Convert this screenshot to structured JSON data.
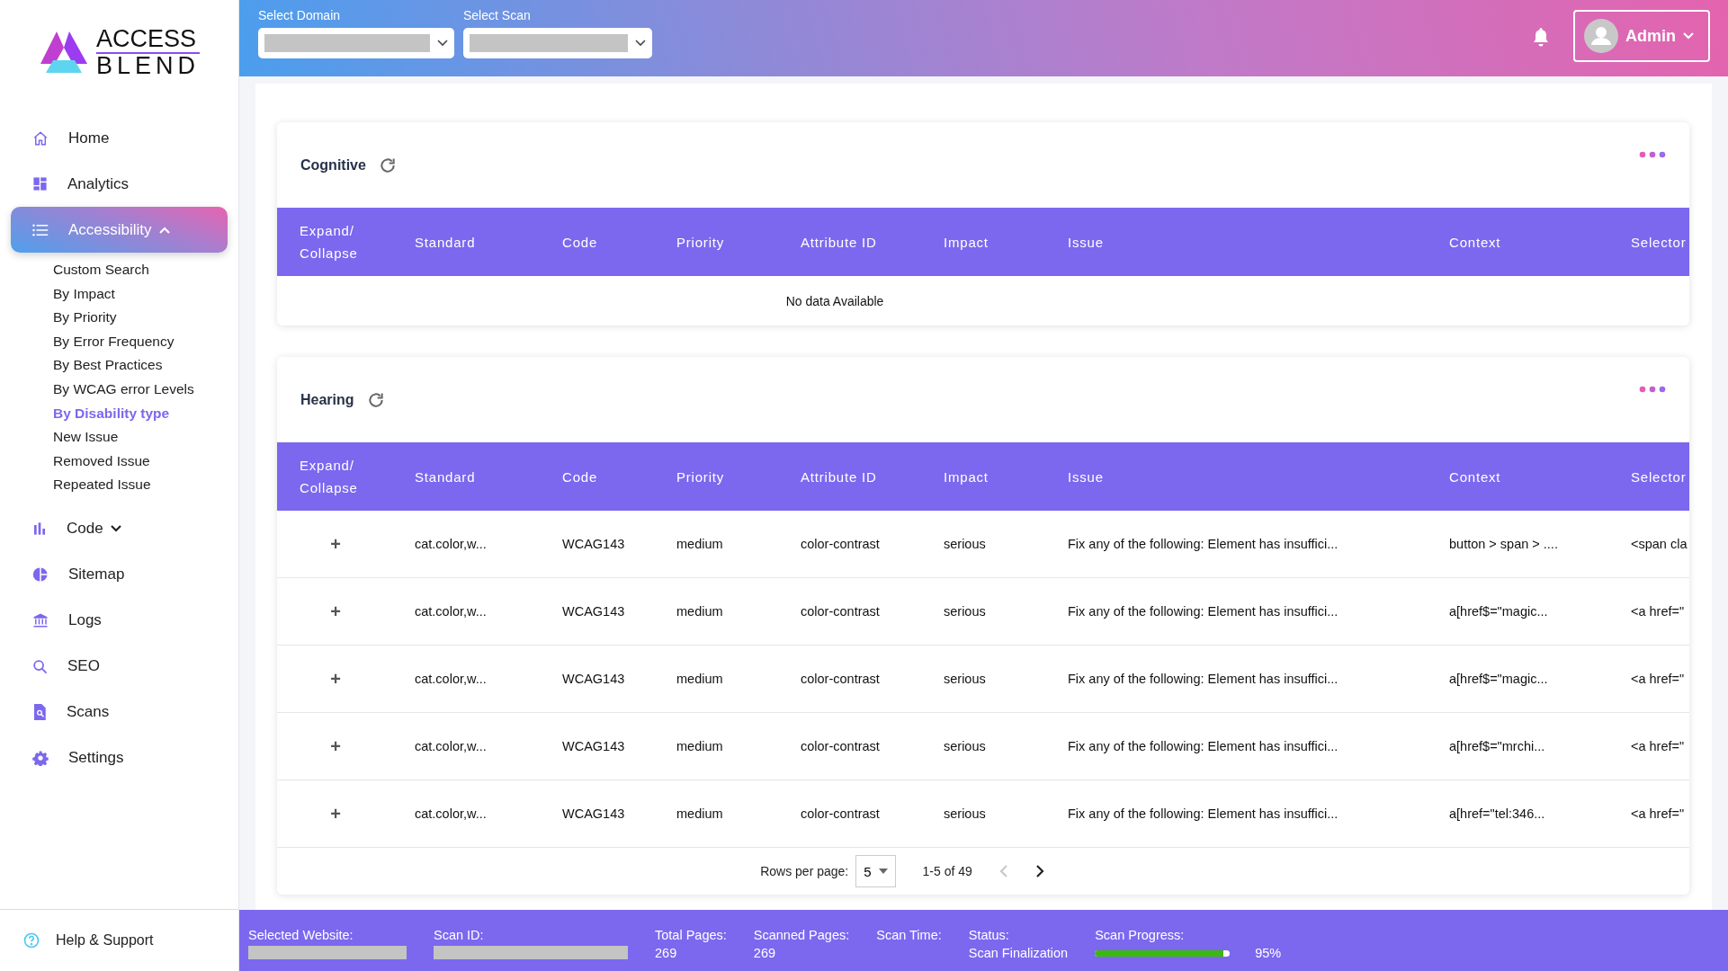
{
  "logo": {
    "line_1": "ACCESS",
    "line_2": "BLEND"
  },
  "sidebar": {
    "items": [
      {
        "label": "Home",
        "selected": false
      },
      {
        "label": "Analytics",
        "selected": false
      },
      {
        "label": "Accessibility",
        "selected": true,
        "expanded": true,
        "children": [
          {
            "label": "Custom Search",
            "selected": false
          },
          {
            "label": "By Impact",
            "selected": false
          },
          {
            "label": "By Priority",
            "selected": false
          },
          {
            "label": "By Error Frequency",
            "selected": false
          },
          {
            "label": "By Best Practices",
            "selected": false
          },
          {
            "label": "By WCAG error Levels",
            "selected": false
          },
          {
            "label": "By Disability type",
            "selected": true
          },
          {
            "label": "New Issue",
            "selected": false
          },
          {
            "label": "Removed Issue",
            "selected": false
          },
          {
            "label": "Repeated Issue",
            "selected": false
          }
        ]
      },
      {
        "label": "Code",
        "selected": false,
        "expanded": false
      },
      {
        "label": "Sitemap",
        "selected": false
      },
      {
        "label": "Logs",
        "selected": false
      },
      {
        "label": "SEO",
        "selected": false
      },
      {
        "label": "Scans",
        "selected": false
      },
      {
        "label": "Settings",
        "selected": false
      }
    ],
    "help": "Help & Support"
  },
  "header": {
    "selects": [
      {
        "label": "Select Domain"
      },
      {
        "label": "Select Scan"
      }
    ],
    "user": "Admin"
  },
  "sections": [
    {
      "title": "Cognitive",
      "columns": [
        "Expand/ Collapse",
        "Standard",
        "Code",
        "Priority",
        "Attribute ID",
        "Impact",
        "Issue",
        "Context",
        "Selector"
      ],
      "empty_message": "No data Available"
    },
    {
      "title": "Hearing",
      "columns": [
        "Expand/ Collapse",
        "Standard",
        "Code",
        "Priority",
        "Attribute ID",
        "Impact",
        "Issue",
        "Context",
        "Selector"
      ],
      "rows": [
        {
          "cells": [
            "+",
            "cat.color,w...",
            "WCAG143",
            "medium",
            "color-contrast",
            "serious",
            "Fix any of the following: Element has insuffici...",
            "button > span > ....",
            "<span cla"
          ]
        },
        {
          "cells": [
            "+",
            "cat.color,w...",
            "WCAG143",
            "medium",
            "color-contrast",
            "serious",
            "Fix any of the following: Element has insuffici...",
            "a[href$=\"magic...",
            "<a href=\""
          ]
        },
        {
          "cells": [
            "+",
            "cat.color,w...",
            "WCAG143",
            "medium",
            "color-contrast",
            "serious",
            "Fix any of the following: Element has insuffici...",
            "a[href$=\"magic...",
            "<a href=\""
          ]
        },
        {
          "cells": [
            "+",
            "cat.color,w...",
            "WCAG143",
            "medium",
            "color-contrast",
            "serious",
            "Fix any of the following: Element has insuffici...",
            "a[href$=\"mrchi...",
            "<a href=\""
          ]
        },
        {
          "cells": [
            "+",
            "cat.color,w...",
            "WCAG143",
            "medium",
            "color-contrast",
            "serious",
            "Fix any of the following: Element has insuffici...",
            "a[href=\"tel:346...",
            "<a href=\""
          ]
        }
      ],
      "pagination": {
        "rows_per_page_label": "Rows per page:",
        "rows_per_page": "5",
        "range": "1-5 of 49",
        "prev": {
          "disabled": true
        },
        "next": {
          "disabled": false
        }
      }
    }
  ],
  "status_bar": [
    {
      "kind": "redacted",
      "label": "Selected Website:"
    },
    {
      "kind": "redacted",
      "label": "Scan ID:"
    },
    {
      "kind": "text",
      "label": "Total Pages:",
      "value": "269"
    },
    {
      "kind": "text",
      "label": "Scanned Pages:",
      "value": "269"
    },
    {
      "kind": "text",
      "label": "Scan Time:"
    },
    {
      "kind": "text",
      "label": "Status:",
      "value": "Scan Finalization"
    },
    {
      "kind": "progress",
      "label": "Scan Progress:",
      "level": 0.95,
      "reading": "95%"
    }
  ]
}
